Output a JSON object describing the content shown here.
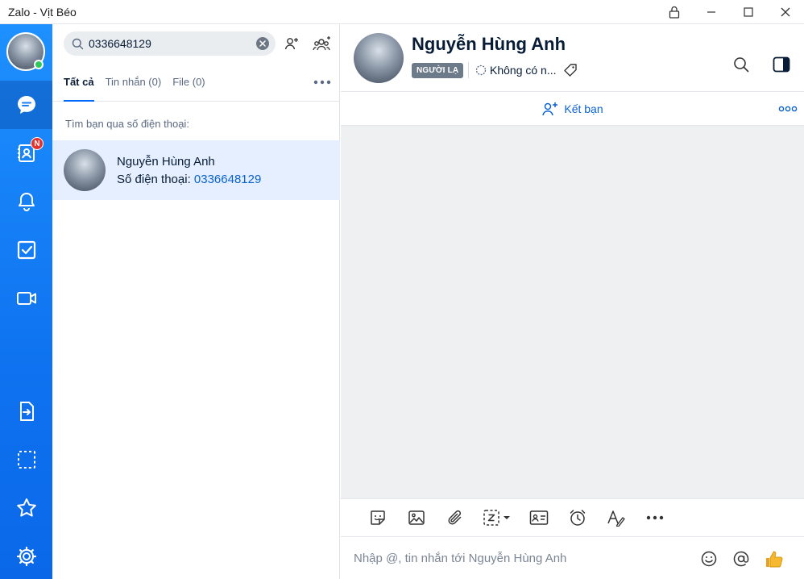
{
  "window": {
    "title": "Zalo - Vịt Béo"
  },
  "nav": {
    "contacts_badge": "N",
    "items": [
      {
        "name": "messages",
        "icon": "chat-icon",
        "active": true
      },
      {
        "name": "contacts",
        "icon": "contact-book-icon",
        "active": false
      },
      {
        "name": "notifications",
        "icon": "bell-icon",
        "active": false
      },
      {
        "name": "todo",
        "icon": "checkbox-icon",
        "active": false
      },
      {
        "name": "video-call",
        "icon": "video-icon",
        "active": false
      },
      {
        "name": "transfer-file",
        "icon": "file-transfer-icon",
        "active": false
      },
      {
        "name": "screenshot",
        "icon": "screenshot-icon",
        "active": false
      },
      {
        "name": "favorites",
        "icon": "star-icon",
        "active": false
      },
      {
        "name": "settings",
        "icon": "gear-icon",
        "active": false
      }
    ]
  },
  "search": {
    "value": "0336648129",
    "placeholder": "Tìm kiếm"
  },
  "tabs": [
    {
      "label": "Tất cả",
      "active": true
    },
    {
      "label": "Tin nhắn (0)",
      "active": false
    },
    {
      "label": "File (0)",
      "active": false
    }
  ],
  "results": {
    "section_label": "Tìm bạn qua số điện thoại:",
    "items": [
      {
        "name": "Nguyễn Hùng Anh",
        "phone_prefix": "Số điện thoại: ",
        "phone": "0336648129"
      }
    ]
  },
  "chat": {
    "name": "Nguyễn Hùng Anh",
    "stranger_tag": "NGƯỜI LẠ",
    "label_text": "Không có n...",
    "add_friend_label": "Kết bạn",
    "compose_placeholder": "Nhập @, tin nhắn tới Nguyễn Hùng Anh"
  },
  "colors": {
    "nav_blue": "#0f73f0",
    "accent": "#0068ff",
    "selected_row": "#e5efff"
  }
}
